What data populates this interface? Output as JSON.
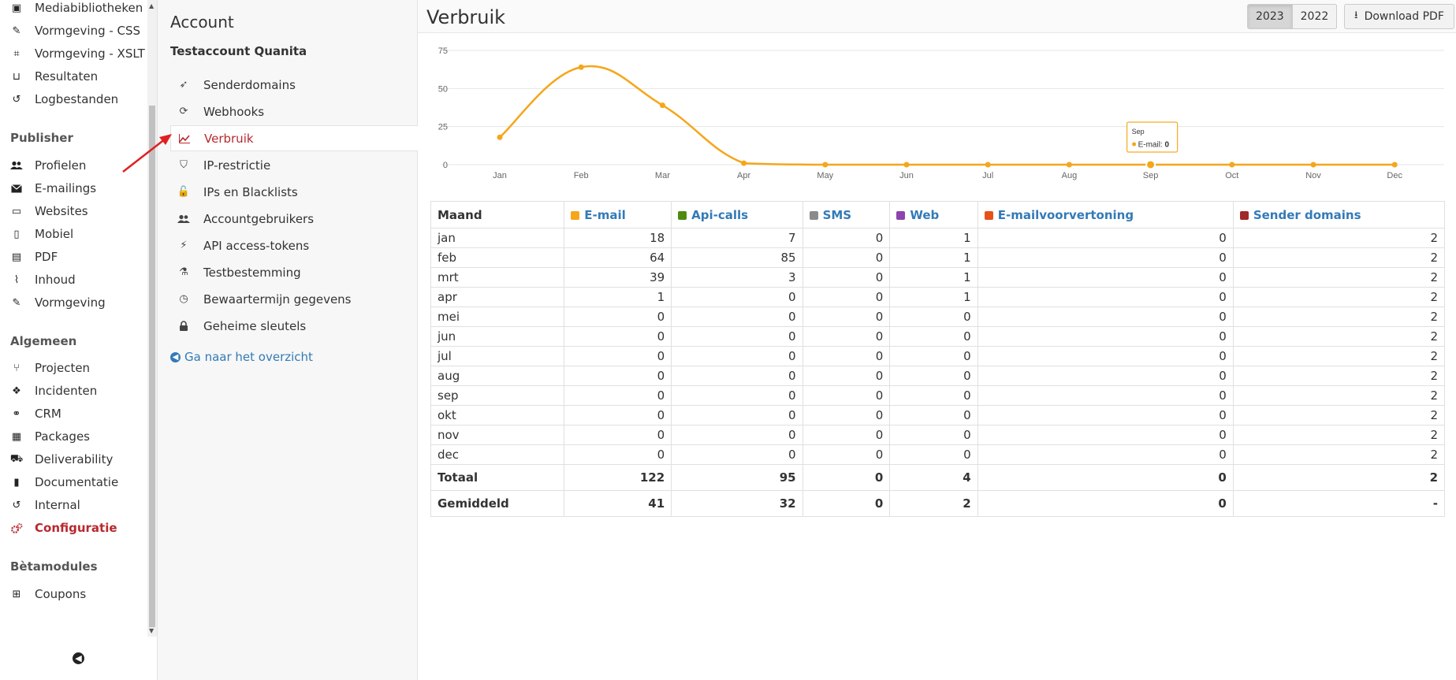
{
  "left_nav": {
    "items_top": [
      {
        "name": "mediabibliotheken",
        "icon": "image-file-icon",
        "label": "Mediabibliotheken"
      },
      {
        "name": "vormgeving-css",
        "icon": "brush-icon",
        "label": "Vormgeving - CSS"
      },
      {
        "name": "vormgeving-xslt",
        "icon": "code-file-icon",
        "label": "Vormgeving - XSLT"
      },
      {
        "name": "resultaten",
        "icon": "inbox-icon",
        "label": "Resultaten"
      },
      {
        "name": "logbestanden",
        "icon": "history-icon",
        "label": "Logbestanden"
      }
    ],
    "section_publisher": "Publisher",
    "items_publisher": [
      {
        "name": "profielen",
        "icon": "users-icon",
        "label": "Profielen"
      },
      {
        "name": "e-mailings",
        "icon": "envelope-icon",
        "label": "E-mailings"
      },
      {
        "name": "websites",
        "icon": "monitor-icon",
        "label": "Websites"
      },
      {
        "name": "mobiel",
        "icon": "mobile-icon",
        "label": "Mobiel"
      },
      {
        "name": "pdf",
        "icon": "pdf-file-icon",
        "label": "PDF"
      },
      {
        "name": "inhoud",
        "icon": "rss-icon",
        "label": "Inhoud"
      },
      {
        "name": "vormgeving",
        "icon": "brush-icon",
        "label": "Vormgeving"
      }
    ],
    "section_algemeen": "Algemeen",
    "items_algemeen": [
      {
        "name": "projecten",
        "icon": "fork-icon",
        "label": "Projecten"
      },
      {
        "name": "incidenten",
        "icon": "cubes-icon",
        "label": "Incidenten"
      },
      {
        "name": "crm",
        "icon": "handshake-icon",
        "label": "CRM"
      },
      {
        "name": "packages",
        "icon": "id-card-icon",
        "label": "Packages"
      },
      {
        "name": "deliverability",
        "icon": "truck-icon",
        "label": "Deliverability"
      },
      {
        "name": "documentatie",
        "icon": "document-icon",
        "label": "Documentatie"
      },
      {
        "name": "internal",
        "icon": "history-icon",
        "label": "Internal"
      },
      {
        "name": "configuratie",
        "icon": "cogs-icon",
        "label": "Configuratie"
      }
    ],
    "section_betamodules": "Bètamodules",
    "items_beta": [
      {
        "name": "coupons",
        "icon": "gift-icon",
        "label": "Coupons"
      }
    ],
    "active": "configuratie"
  },
  "account_panel": {
    "title": "Account",
    "subtitle": "Testaccount Quanita",
    "items": [
      {
        "name": "senderdomains",
        "icon": "rocket-icon",
        "label": "Senderdomains"
      },
      {
        "name": "webhooks",
        "icon": "refresh-icon",
        "label": "Webhooks"
      },
      {
        "name": "verbruik",
        "icon": "line-chart-icon",
        "label": "Verbruik"
      },
      {
        "name": "ip-restrictie",
        "icon": "shield-icon",
        "label": "IP-restrictie"
      },
      {
        "name": "ips-en-blacklists",
        "icon": "lock-open-icon",
        "label": "IPs en Blacklists"
      },
      {
        "name": "accountgebruikers",
        "icon": "users-icon",
        "label": "Accountgebruikers"
      },
      {
        "name": "api-access-tokens",
        "icon": "plug-icon",
        "label": "API access-tokens"
      },
      {
        "name": "testbestemming",
        "icon": "flask-icon",
        "label": "Testbestemming"
      },
      {
        "name": "bewaartermijn-gegevens",
        "icon": "clock-icon",
        "label": "Bewaartermijn gegevens"
      },
      {
        "name": "geheime-sleutels",
        "icon": "lock-icon",
        "label": "Geheime sleutels"
      }
    ],
    "active": "verbruik",
    "overview_link": "Ga naar het overzicht"
  },
  "header": {
    "title": "Verbruik",
    "years": [
      "2023",
      "2022"
    ],
    "active_year": "2023",
    "download_label": "Download PDF"
  },
  "chart_data": {
    "type": "line",
    "x": [
      "Jan",
      "Feb",
      "Mar",
      "Apr",
      "May",
      "Jun",
      "Jul",
      "Aug",
      "Sep",
      "Oct",
      "Nov",
      "Dec"
    ],
    "series": [
      {
        "name": "E-mail",
        "color": "#f5a61a",
        "values": [
          18,
          64,
          39,
          1,
          0,
          0,
          0,
          0,
          0,
          0,
          0,
          0
        ]
      }
    ],
    "yticks": [
      0,
      25,
      50,
      75
    ],
    "ylim": [
      0,
      75
    ],
    "grid": true,
    "tooltip": {
      "category": "Sep",
      "label": "E-mail",
      "value": "0"
    }
  },
  "table": {
    "month_header": "Maand",
    "columns": [
      {
        "label": "E-mail",
        "color": "#f5a61a"
      },
      {
        "label": "Api-calls",
        "color": "#4f8a10"
      },
      {
        "label": "SMS",
        "color": "#8a8a8a"
      },
      {
        "label": "Web",
        "color": "#8e44ad"
      },
      {
        "label": "E-mailvoorvertoning",
        "color": "#e8501a"
      },
      {
        "label": "Sender domains",
        "color": "#a02828"
      }
    ],
    "rows": [
      {
        "month": "jan",
        "values": [
          "18",
          "7",
          "0",
          "1",
          "0",
          "2"
        ]
      },
      {
        "month": "feb",
        "values": [
          "64",
          "85",
          "0",
          "1",
          "0",
          "2"
        ]
      },
      {
        "month": "mrt",
        "values": [
          "39",
          "3",
          "0",
          "1",
          "0",
          "2"
        ]
      },
      {
        "month": "apr",
        "values": [
          "1",
          "0",
          "0",
          "1",
          "0",
          "2"
        ]
      },
      {
        "month": "mei",
        "values": [
          "0",
          "0",
          "0",
          "0",
          "0",
          "2"
        ]
      },
      {
        "month": "jun",
        "values": [
          "0",
          "0",
          "0",
          "0",
          "0",
          "2"
        ]
      },
      {
        "month": "jul",
        "values": [
          "0",
          "0",
          "0",
          "0",
          "0",
          "2"
        ]
      },
      {
        "month": "aug",
        "values": [
          "0",
          "0",
          "0",
          "0",
          "0",
          "2"
        ]
      },
      {
        "month": "sep",
        "values": [
          "0",
          "0",
          "0",
          "0",
          "0",
          "2"
        ]
      },
      {
        "month": "okt",
        "values": [
          "0",
          "0",
          "0",
          "0",
          "0",
          "2"
        ]
      },
      {
        "month": "nov",
        "values": [
          "0",
          "0",
          "0",
          "0",
          "0",
          "2"
        ]
      },
      {
        "month": "dec",
        "values": [
          "0",
          "0",
          "0",
          "0",
          "0",
          "2"
        ]
      }
    ],
    "summary": [
      {
        "label": "Totaal",
        "values": [
          "122",
          "95",
          "0",
          "4",
          "0",
          "2"
        ]
      },
      {
        "label": "Gemiddeld",
        "values": [
          "41",
          "32",
          "0",
          "2",
          "0",
          "-"
        ]
      }
    ]
  }
}
